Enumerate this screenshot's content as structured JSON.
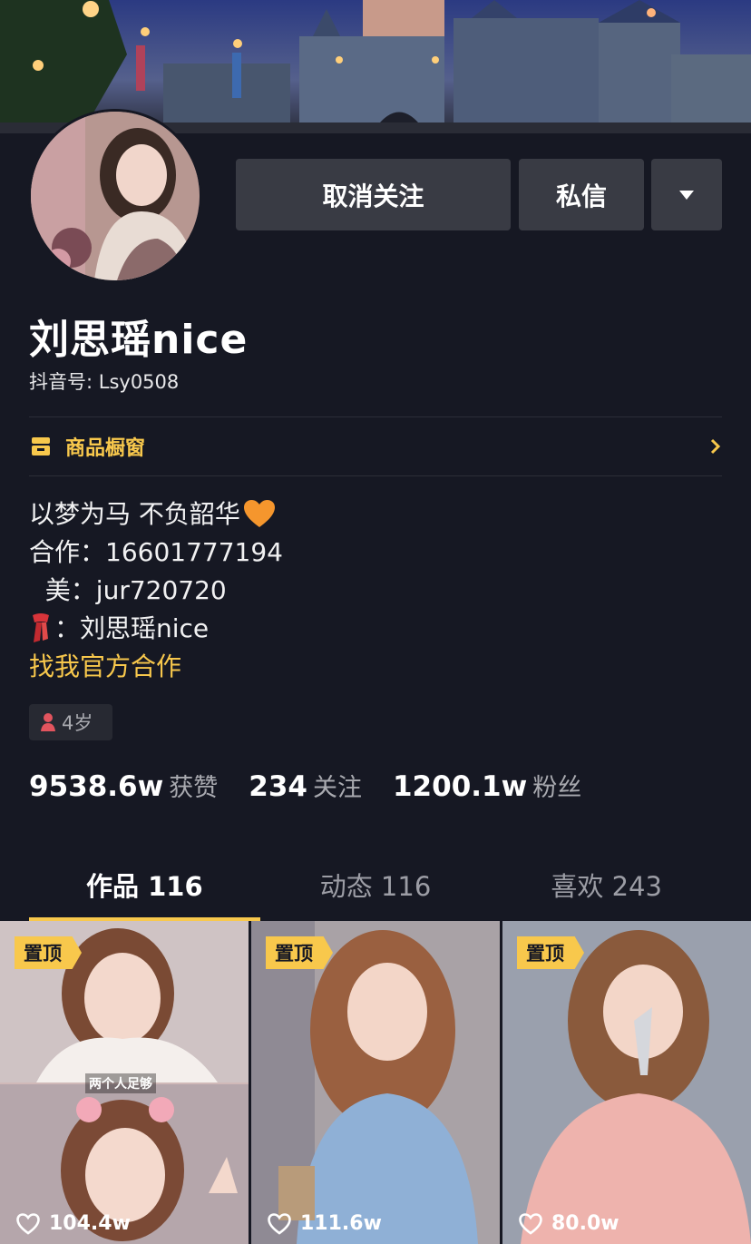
{
  "profile": {
    "name": "刘思瑶nice",
    "douyin_id": "抖音号: Lsy0508",
    "age_tag": "4岁"
  },
  "actions": {
    "unfollow_label": "取消关注",
    "message_label": "私信"
  },
  "shop": {
    "label": "商品橱窗"
  },
  "bio": {
    "line1": "以梦为马 不负韶华",
    "line2": "合作：16601777194",
    "line3": "  美：jur720720",
    "line4": "：刘思瑶nice",
    "coop_link": "找我官方合作"
  },
  "stats": [
    {
      "value": "9538.6w",
      "label": "获赞"
    },
    {
      "value": "234",
      "label": "关注"
    },
    {
      "value": "1200.1w",
      "label": "粉丝"
    }
  ],
  "tabs": [
    {
      "label": "作品 116",
      "active": true
    },
    {
      "label": "动态 116",
      "active": false
    },
    {
      "label": "喜欢 243",
      "active": false
    }
  ],
  "videos": [
    {
      "pinned_label": "置顶",
      "likes": "104.4w",
      "caption": "两个人足够"
    },
    {
      "pinned_label": "置顶",
      "likes": "111.6w"
    },
    {
      "pinned_label": "置顶",
      "likes": "80.0w"
    }
  ],
  "colors": {
    "accent": "#f8c84c",
    "background": "#161823",
    "button": "#393b44"
  }
}
